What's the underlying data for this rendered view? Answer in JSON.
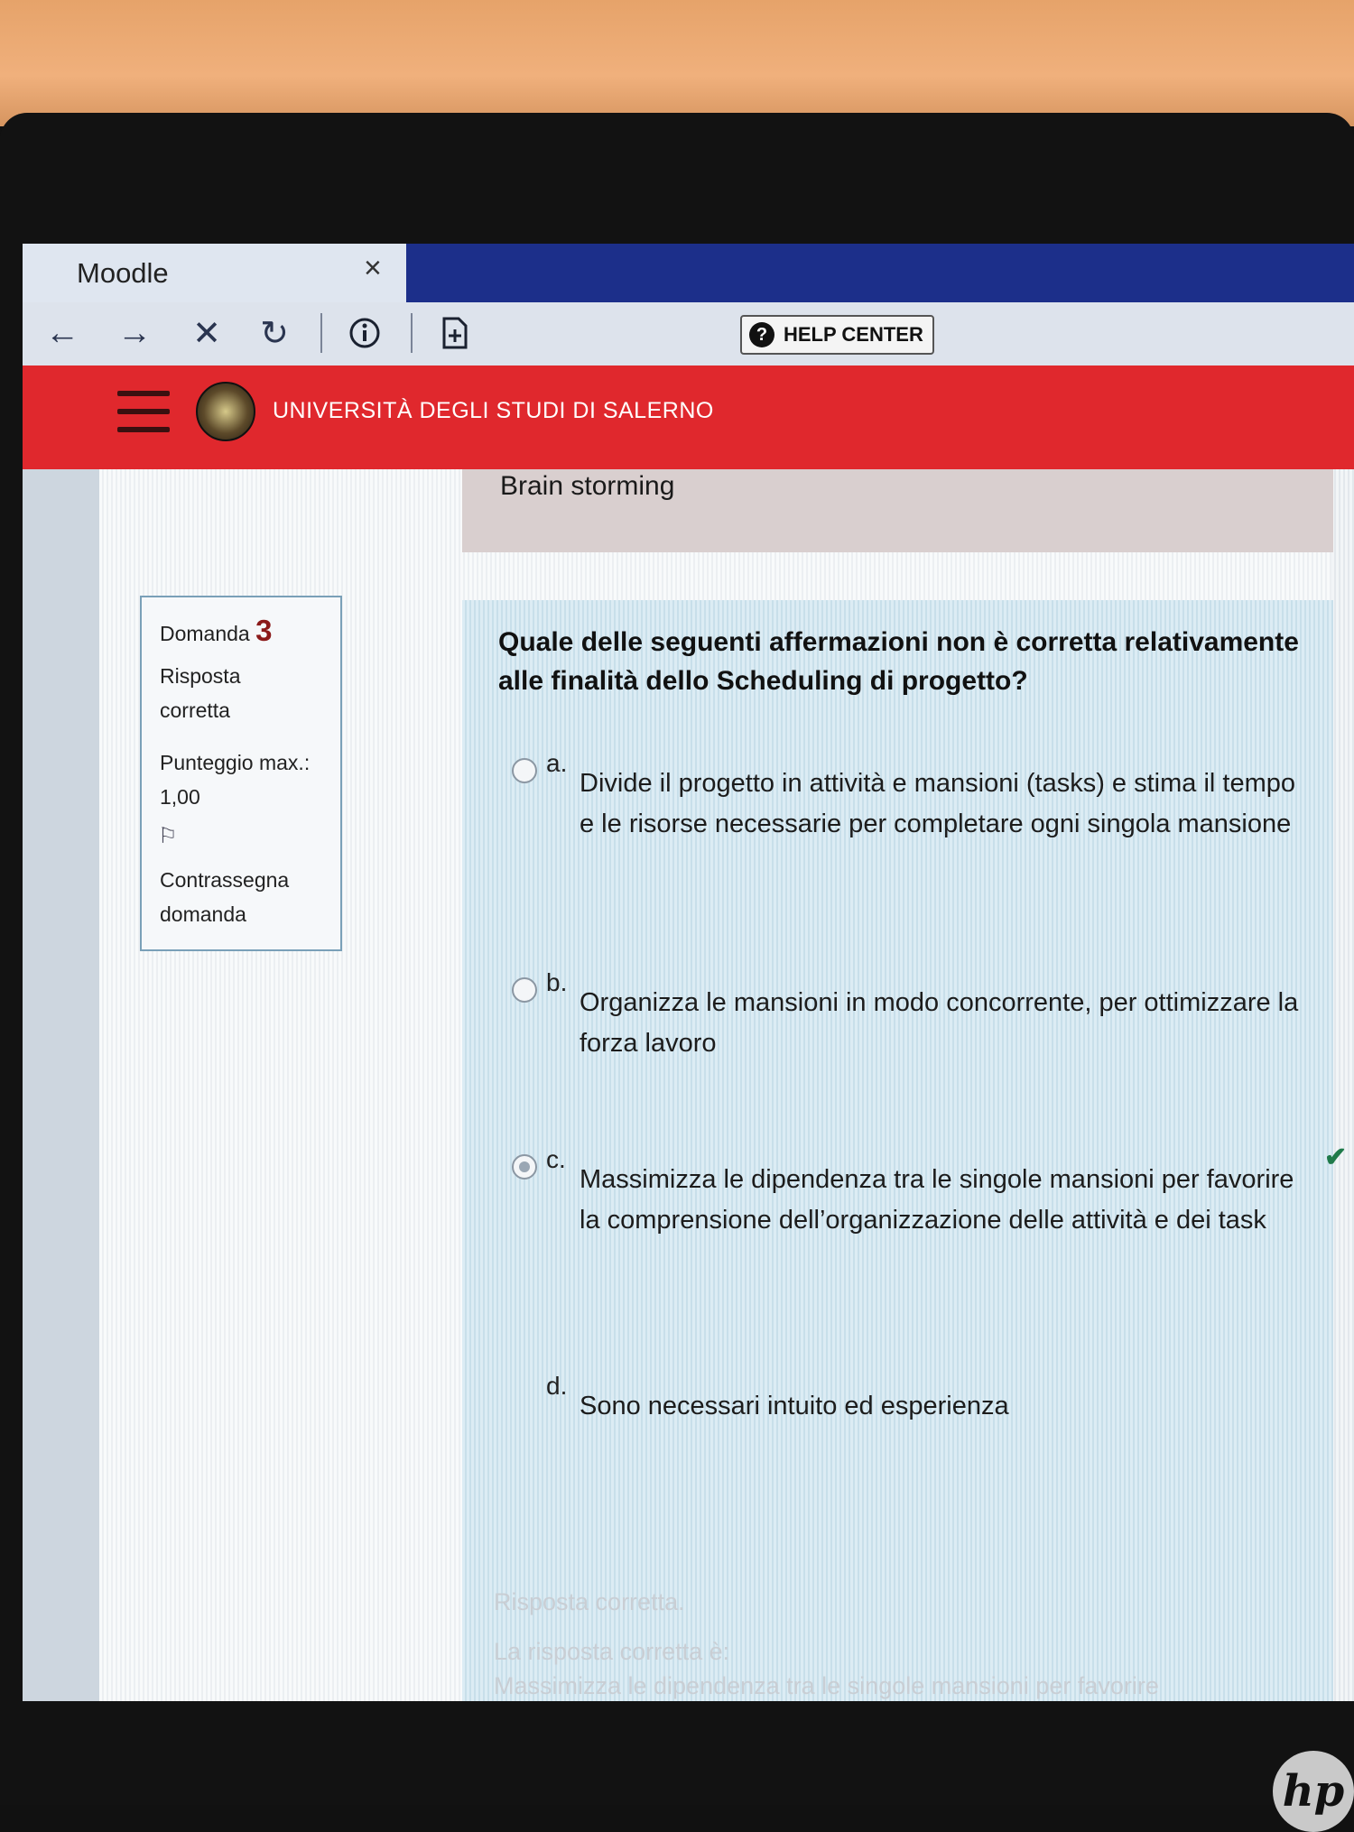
{
  "browser": {
    "tab_title": "Moodle",
    "tab_close": "×",
    "help_center": "HELP CENTER"
  },
  "site": {
    "name": "UNIVERSITÀ DEGLI STUDI DI SALERNO"
  },
  "section": {
    "title": "Brain storming"
  },
  "question_info": {
    "label": "Domanda",
    "number": "3",
    "status_line1": "Risposta",
    "status_line2": "corretta",
    "score_line1": "Punteggio max.:",
    "score_line2": "1,00",
    "flag_line1": "Contrassegna",
    "flag_line2": "domanda"
  },
  "question": {
    "text": "Quale delle seguenti affermazioni non è corretta relativamente alle finalità dello Scheduling di progetto?",
    "options": [
      {
        "letter": "a.",
        "text": "Divide il progetto in attività e mansioni (tasks) e stima il tempo e le risorse necessarie per completare ogni singola mansione",
        "selected": false
      },
      {
        "letter": "b.",
        "text": "Organizza le mansioni in modo concorrente, per ottimizzare la forza lavoro",
        "selected": false
      },
      {
        "letter": "c.",
        "text": "Massimizza le dipendenza tra le singole mansioni per favorire la comprensione dell’organizzazione delle attività e dei task",
        "selected": true
      },
      {
        "letter": "d.",
        "text": "Sono necessari intuito ed esperienza",
        "selected": false
      }
    ]
  },
  "feedback": {
    "line1": "Risposta corretta.",
    "line2": "La risposta corretta è:",
    "line3": "Massimizza le dipendenza tra le singole mansioni per favorire"
  },
  "device": {
    "brand": "hp"
  }
}
